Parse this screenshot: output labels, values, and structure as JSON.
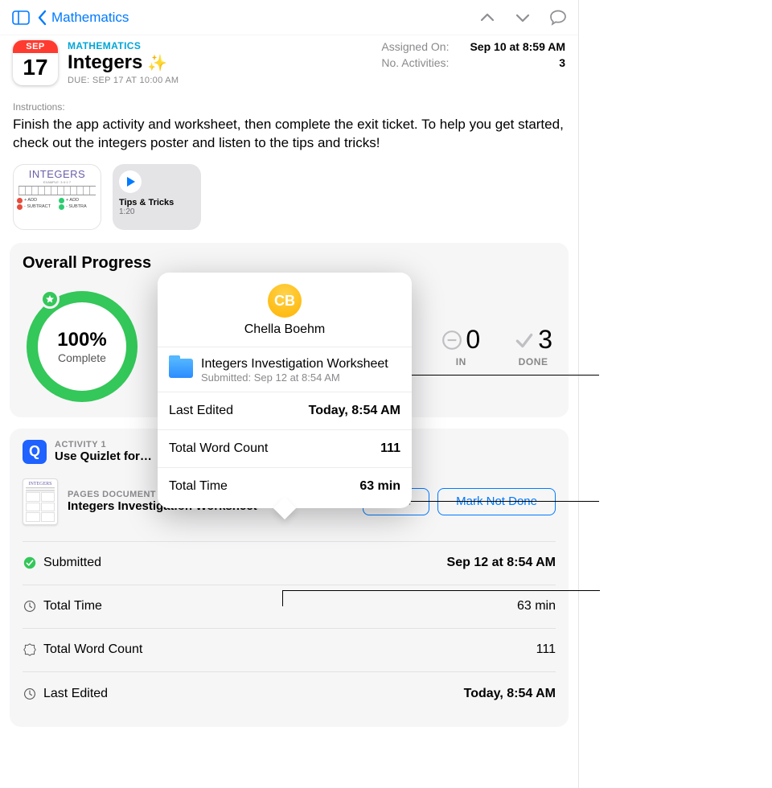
{
  "nav": {
    "back_label": "Mathematics"
  },
  "calendar": {
    "month": "SEP",
    "day": "17"
  },
  "header": {
    "subject": "MATHEMATICS",
    "title": "Integers",
    "sparkle": "✨",
    "due": "DUE: SEP 17 AT 10:00 AM",
    "assigned_label": "Assigned On:",
    "assigned_value": "Sep 10 at 8:59 AM",
    "activities_label": "No. Activities:",
    "activities_value": "3"
  },
  "instructions_label": "Instructions:",
  "instructions": "Finish the app activity and worksheet, then complete the exit ticket. To help you get started, check out the integers poster and listen to the tips and tricks!",
  "attachments": {
    "poster_heading": "INTEGERS",
    "audio_title": "Tips & Tricks",
    "audio_duration": "1:20"
  },
  "progress": {
    "heading": "Overall Progress",
    "percent": "100%",
    "percent_sub": "Complete",
    "incomplete_num": "0",
    "incomplete_cap": "IN",
    "done_num": "3",
    "done_cap": "DONE"
  },
  "activity": {
    "overline": "ACTIVITY 1",
    "title": "Use Quizlet for…"
  },
  "document": {
    "overline": "PAGES DOCUMENT",
    "title": "Integers Investigation Worksheet",
    "open_label": "Open",
    "mark_label": "Mark Not Done"
  },
  "rows": {
    "submitted_label": "Submitted",
    "submitted_value": "Sep 12 at 8:54 AM",
    "time_label": "Total Time",
    "time_value": "63 min",
    "words_label": "Total Word Count",
    "words_value": "111",
    "edited_label": "Last Edited",
    "edited_value": "Today, 8:54 AM"
  },
  "popover": {
    "initials": "CB",
    "student": "Chella Boehm",
    "file_title": "Integers Investigation Worksheet",
    "file_sub": "Submitted: Sep 12 at 8:54 AM",
    "r1_label": "Last Edited",
    "r1_value": "Today, 8:54 AM",
    "r2_label": "Total Word Count",
    "r2_value": "111",
    "r3_label": "Total Time",
    "r3_value": "63 min"
  }
}
